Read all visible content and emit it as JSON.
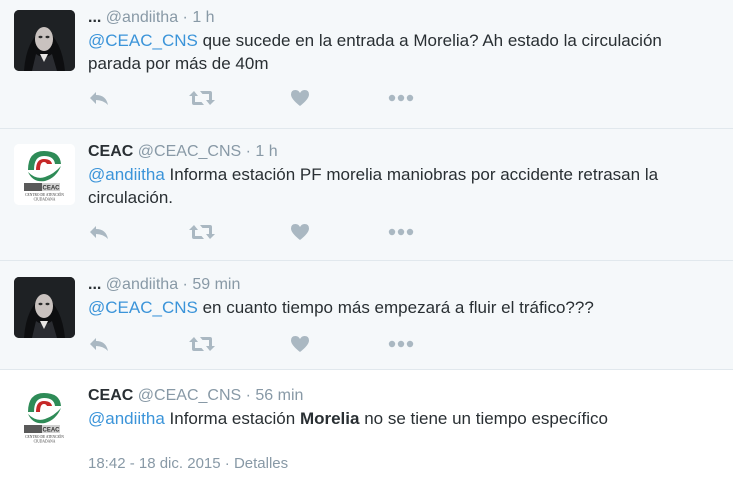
{
  "tweets": [
    {
      "name": "...",
      "handle": "@andiitha",
      "sep": "·",
      "time": "1 h",
      "mention": "@CEAC_CNS",
      "body": " que sucede en la entrada a Morelia? Ah estado la circulación parada por más de 40m"
    },
    {
      "name": "CEAC",
      "handle": "@CEAC_CNS",
      "sep": "·",
      "time": "1 h",
      "mention": "@andiitha",
      "body": " Informa estación PF morelia maniobras por accidente retrasan la circulación."
    },
    {
      "name": "...",
      "handle": "@andiitha",
      "sep": "·",
      "time": "59 min",
      "mention": "@CEAC_CNS",
      "body": " en cuanto tiempo más empezará a fluir el tráfico???"
    },
    {
      "name": "CEAC",
      "handle": "@CEAC_CNS",
      "sep": "·",
      "time": "56 min",
      "mention": "@andiitha",
      "body_a": " Informa estación ",
      "body_bold": "Morelia",
      "body_b": " no se tiene un tiempo específico",
      "timestamp": "18:42 - 18 dic. 2015",
      "footer_sep": "·",
      "details_label": "Detalles"
    }
  ],
  "logo": {
    "line1": "CEAC",
    "line2": "CENTRO DE ATENCIÓN",
    "line3": "CIUDADANA"
  },
  "icons": [
    "reply-icon",
    "retweet-icon",
    "like-icon",
    "more-icon"
  ],
  "colors": {
    "mention": "#3b94d9",
    "meta": "#8899a6",
    "action": "#aab8c2",
    "conversation_bg": "#f5f8fa",
    "focused_bg": "#ffffff"
  }
}
